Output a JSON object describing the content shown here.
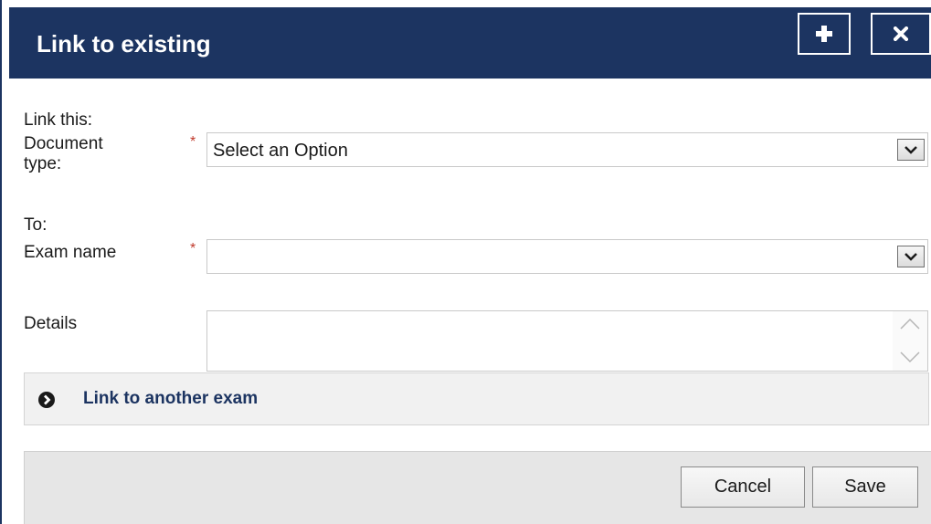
{
  "dialog": {
    "title": "Link to existing",
    "plus_icon": "plus-icon",
    "close_icon": "close-icon"
  },
  "form": {
    "link_this_label": "Link this:",
    "document_type_label_line1": "Document",
    "document_type_label_line2": "type:",
    "required_marker": "*",
    "document_type_value": "Select an Option",
    "to_label": "To:",
    "exam_name_label": "Exam name",
    "exam_name_value": "",
    "details_label": "Details",
    "details_value": ""
  },
  "link_another": {
    "label": "Link to another exam",
    "icon": "chevron-circle-right-icon"
  },
  "footer": {
    "cancel_label": "Cancel",
    "save_label": "Save"
  },
  "colors": {
    "header_bg": "#1c3461",
    "required": "#c0392b",
    "link_text": "#1c3461"
  }
}
